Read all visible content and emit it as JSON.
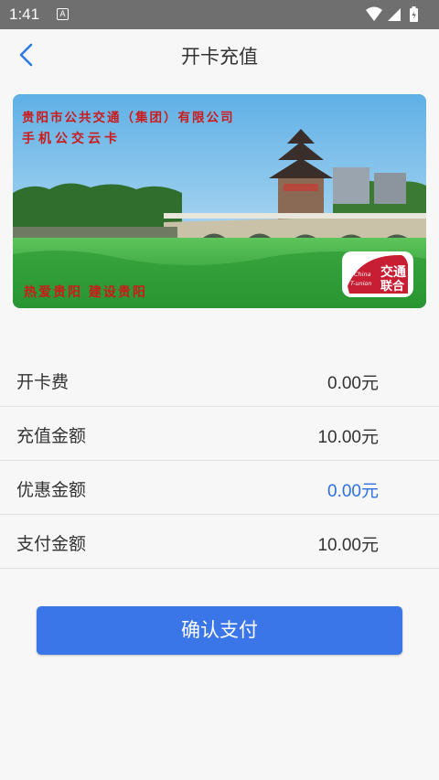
{
  "status_bar": {
    "time": "1:41",
    "notification_letter": "A"
  },
  "nav": {
    "title": "开卡充值",
    "back_icon": "chevron-left-icon"
  },
  "card": {
    "line1": "贵阳市公共交通（集团）有限公司",
    "line2": "手机公交云卡",
    "slogan": "热爱贵阳   建设贵阳",
    "logo_top": "交通",
    "logo_bottom": "联合",
    "logo_en_top": "China",
    "logo_en_bottom": "T-union"
  },
  "rows": [
    {
      "label": "开卡费",
      "value": "0.00元"
    },
    {
      "label": "充值金额",
      "value": "10.00元"
    },
    {
      "label": "优惠金额",
      "value": "0.00元"
    },
    {
      "label": "支付金额",
      "value": "10.00元"
    }
  ],
  "pay_button": {
    "label": "确认支付"
  },
  "colors": {
    "accent": "#3b76e8",
    "discount": "#2d6fe0"
  }
}
